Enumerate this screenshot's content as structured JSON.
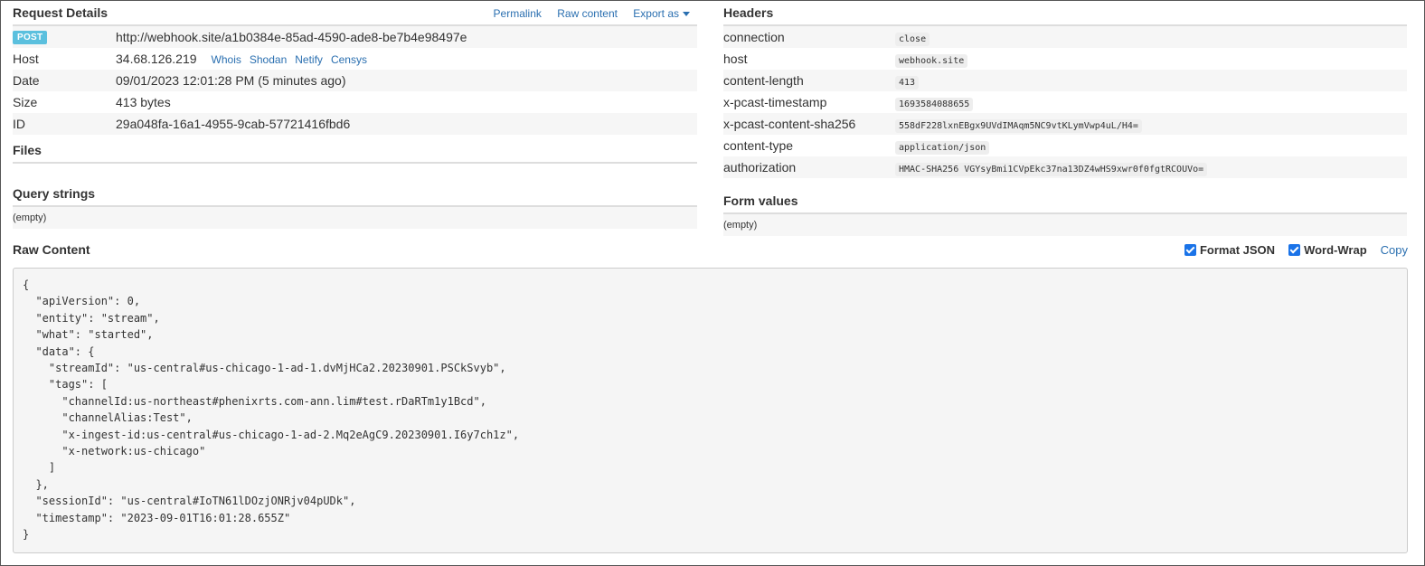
{
  "request_details": {
    "title": "Request Details",
    "actions": {
      "permalink": "Permalink",
      "raw_content": "Raw content",
      "export_as": "Export as"
    },
    "method_badge": "POST",
    "url": "http://webhook.site/a1b0384e-85ad-4590-ade8-be7b4e98497e",
    "rows": [
      {
        "label": "Host",
        "value": "34.68.126.219"
      },
      {
        "label": "Date",
        "value": "09/01/2023 12:01:28 PM (5 minutes ago)"
      },
      {
        "label": "Size",
        "value": "413 bytes"
      },
      {
        "label": "ID",
        "value": "29a048fa-16a1-4955-9cab-57721416fbd6"
      }
    ],
    "host_links": [
      "Whois",
      "Shodan",
      "Netify",
      "Censys"
    ]
  },
  "files": {
    "title": "Files"
  },
  "query_strings": {
    "title": "Query strings",
    "empty": "(empty)"
  },
  "headers": {
    "title": "Headers",
    "rows": [
      {
        "name": "connection",
        "value": "close"
      },
      {
        "name": "host",
        "value": "webhook.site"
      },
      {
        "name": "content-length",
        "value": "413"
      },
      {
        "name": "x-pcast-timestamp",
        "value": "1693584088655"
      },
      {
        "name": "x-pcast-content-sha256",
        "value": "558dF228lxnEBgx9UVdIMAqm5NC9vtKLymVwp4uL/H4="
      },
      {
        "name": "content-type",
        "value": "application/json"
      },
      {
        "name": "authorization",
        "value": "HMAC-SHA256 VGYsyBmi1CVpEkc37na13DZ4wHS9xwr0f0fgtRCOUVo="
      }
    ]
  },
  "form_values": {
    "title": "Form values",
    "empty": "(empty)"
  },
  "raw_content": {
    "title": "Raw Content",
    "format_json": "Format JSON",
    "format_json_checked": true,
    "word_wrap": "Word-Wrap",
    "word_wrap_checked": true,
    "copy": "Copy",
    "body": "{\n  \"apiVersion\": 0,\n  \"entity\": \"stream\",\n  \"what\": \"started\",\n  \"data\": {\n    \"streamId\": \"us-central#us-chicago-1-ad-1.dvMjHCa2.20230901.PSCkSvyb\",\n    \"tags\": [\n      \"channelId:us-northeast#phenixrts.com-ann.lim#test.rDaRTm1y1Bcd\",\n      \"channelAlias:Test\",\n      \"x-ingest-id:us-central#us-chicago-1-ad-2.Mq2eAgC9.20230901.I6y7ch1z\",\n      \"x-network:us-chicago\"\n    ]\n  },\n  \"sessionId\": \"us-central#IoTN61lDOzjONRjv04pUDk\",\n  \"timestamp\": \"2023-09-01T16:01:28.655Z\"\n}"
  },
  "colors": {
    "link": "#2a6fb0",
    "badge": "#5bc0de",
    "checkbox": "#1a73e8"
  }
}
